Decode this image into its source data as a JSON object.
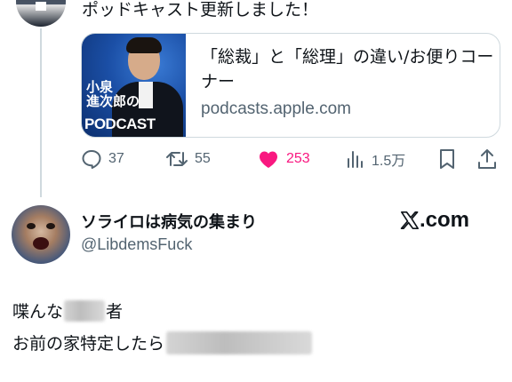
{
  "post": {
    "text": "ポッドキャスト更新しました！",
    "card": {
      "thumb_name_line1": "小泉",
      "thumb_name_line2": "進次郎の",
      "thumb_podcast": "PODCAST",
      "title": "「総裁」と「総理」の違い/お便りコーナー",
      "domain": "podcasts.apple.com"
    },
    "actions": {
      "replies": "37",
      "reposts": "55",
      "likes": "253",
      "views": "1.5万"
    }
  },
  "reply": {
    "display_name": "ソライロは病気の集まり",
    "handle": "@LibdemsFuck",
    "watermark": ".com",
    "line1_before": "喋んな",
    "line1_after": "者",
    "line2": "お前の家特定したら"
  },
  "colors": {
    "text": "#0f1419",
    "secondary": "#536471",
    "like": "#f91880",
    "border": "#cfd9de"
  }
}
